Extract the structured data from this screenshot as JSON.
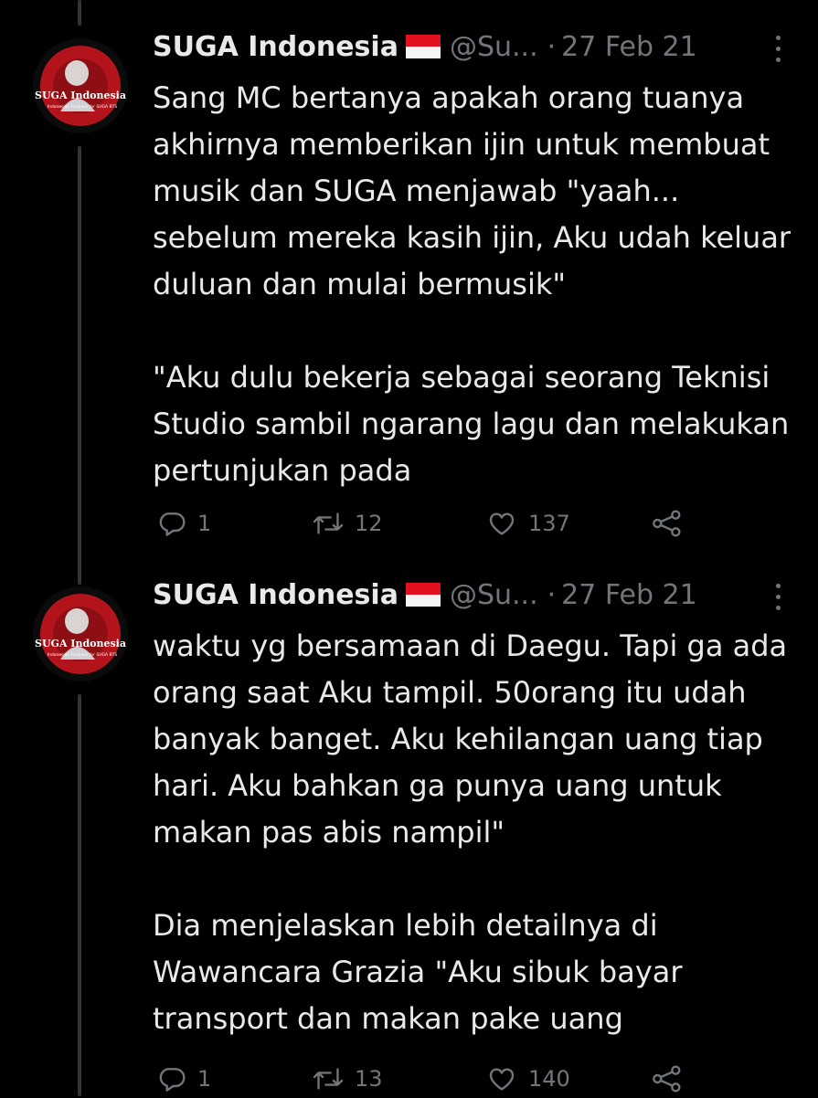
{
  "tweets": [
    {
      "display_name": "SUGA Indonesia",
      "flag": "🇮🇩",
      "handle": "@Su...",
      "separator": "·",
      "date": "27 Feb 21",
      "avatar_text": "SUGA Indonesia",
      "avatar_subtext": "Indonesian Fanbase for SUGA BTS",
      "paragraphs": [
        "Sang MC bertanya apakah orang tuanya akhirnya memberikan ijin untuk membuat musik dan SUGA menjawab \"yaah... sebelum mereka kasih ijin, Aku udah keluar duluan dan mulai bermusik\"",
        "\"Aku dulu bekerja sebagai seorang Teknisi Studio sambil ngarang lagu dan melakukan pertunjukan pada"
      ],
      "reply_count": "1",
      "retweet_count": "12",
      "like_count": "137"
    },
    {
      "display_name": "SUGA Indonesia",
      "flag": "🇮🇩",
      "handle": "@Su...",
      "separator": "·",
      "date": "27 Feb 21",
      "avatar_text": "SUGA Indonesia",
      "avatar_subtext": "Indonesian Fanbase for SUGA BTS",
      "paragraphs": [
        "waktu yg bersamaan di Daegu. Tapi ga ada orang saat Aku tampil. 50orang itu udah banyak banget. Aku kehilangan uang tiap hari. Aku bahkan ga punya uang untuk makan pas abis nampil\"",
        "Dia menjelaskan lebih detailnya di Wawancara Grazia \"Aku sibuk bayar transport dan makan pake uang"
      ],
      "reply_count": "1",
      "retweet_count": "13",
      "like_count": "140"
    }
  ],
  "icons": {
    "reply": "reply-icon",
    "retweet": "retweet-icon",
    "like": "heart-icon",
    "share": "share-icon",
    "more": "more-options-icon"
  },
  "colors": {
    "background": "#000000",
    "text": "#e7e9ea",
    "secondary": "#71767b",
    "thread_line": "#333639",
    "avatar_red": "#b3141b"
  }
}
